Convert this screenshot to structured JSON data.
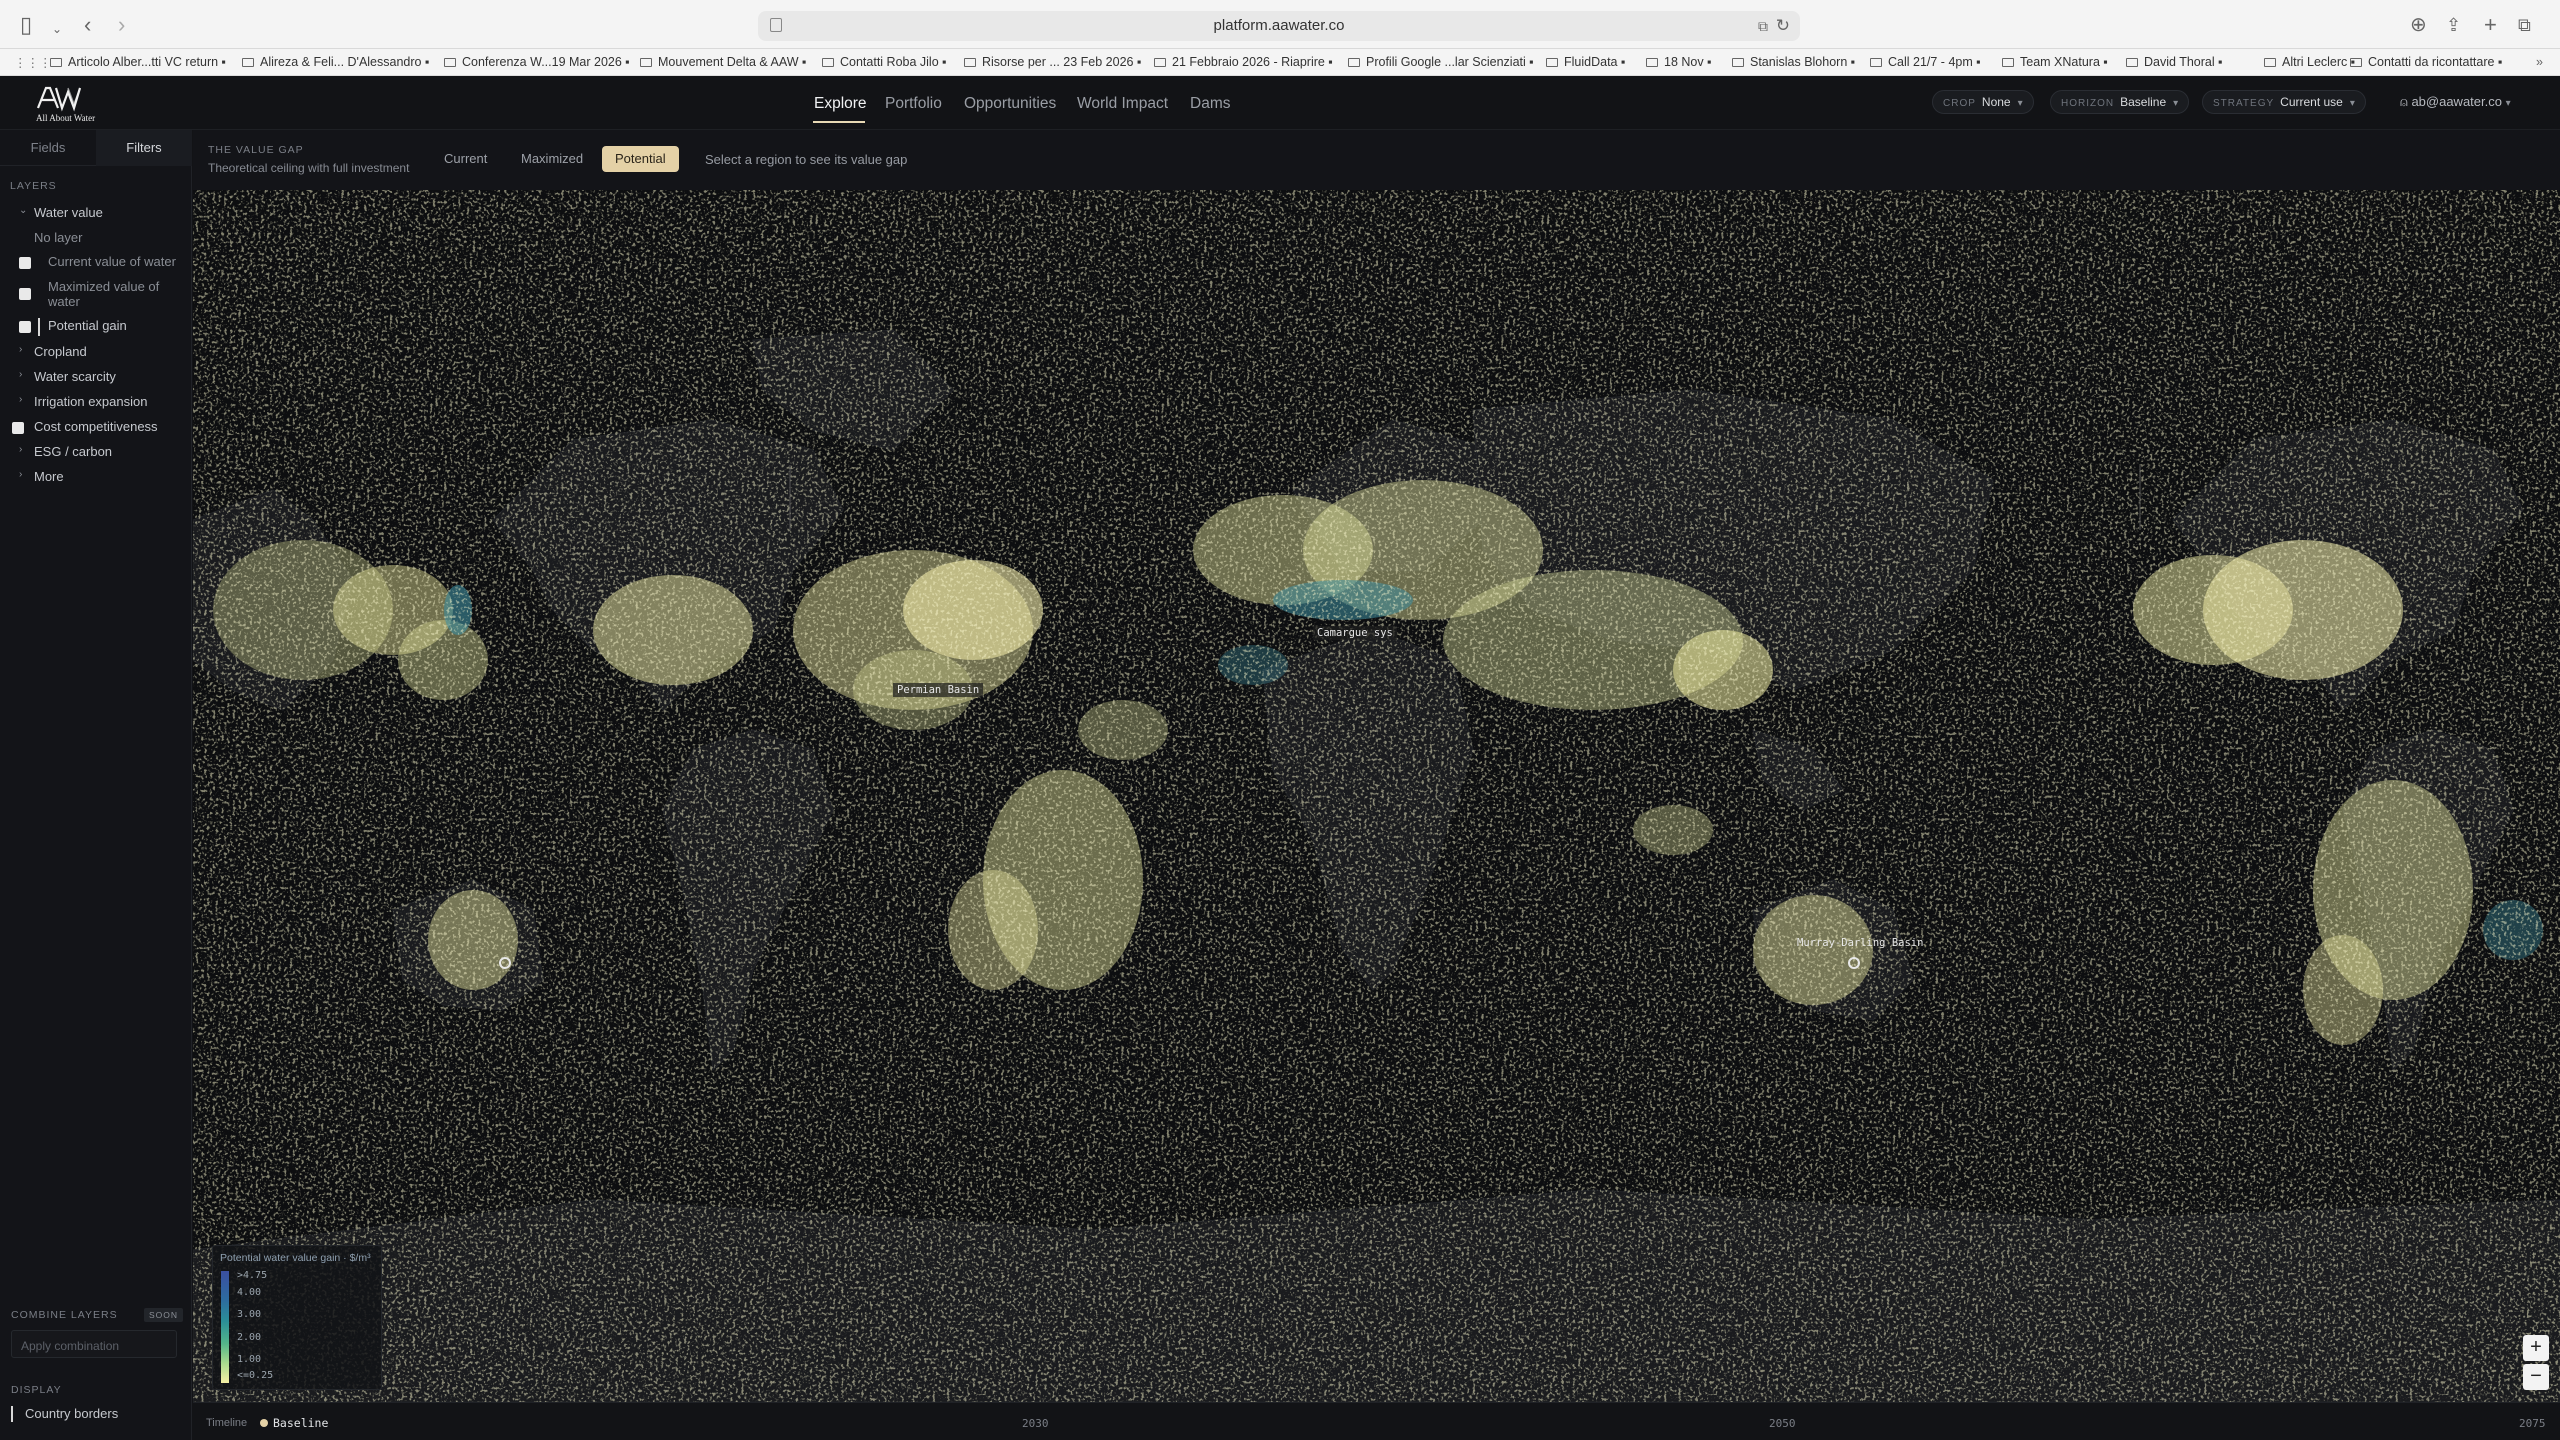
{
  "browser": {
    "url": "platform.aawater.co",
    "bookmarks": [
      "Articolo Alber...tti VC return",
      "Alireza & Feli... D'Alessandro",
      "Conferenza W...19 Mar 2026",
      "Mouvement Delta & AAW",
      "Contatti Roba Jilo",
      "Risorse per ... 23 Feb 2026",
      "21 Febbraio 2026 - Riaprire",
      "Profili Google ...lar Scienziati",
      "FluidData",
      "18 Nov",
      "Stanislas Blohorn",
      "Call 21/7 - 4pm",
      "Team XNatura",
      "David Thoral",
      "Altri Leclerc",
      "Contatti da ricontattare"
    ]
  },
  "app": {
    "logo_text": "All About Water",
    "nav": [
      "Explore",
      "Portfolio",
      "Opportunities",
      "World Impact",
      "Dams"
    ],
    "filters": [
      {
        "key": "CROP",
        "value": "None"
      },
      {
        "key": "HORIZON",
        "value": "Baseline"
      },
      {
        "key": "STRATEGY",
        "value": "Current use"
      }
    ],
    "user": "ab@aawater.co"
  },
  "sidebar": {
    "tabs": [
      "Fields",
      "Filters"
    ],
    "layers_label": "LAYERS",
    "water_value": {
      "label": "Water value",
      "no_layer": "No layer",
      "items": [
        "Current value of water",
        "Maximized value of water",
        "Potential gain"
      ]
    },
    "groups": [
      "Cropland",
      "Water scarcity",
      "Irrigation expansion",
      "Cost competitiveness",
      "ESG / carbon",
      "More"
    ],
    "combine_label": "COMBINE LAYERS",
    "combine_badge": "SOON",
    "combine_placeholder": "Apply combination",
    "display_label": "DISPLAY",
    "display_item": "Country borders"
  },
  "value_gap": {
    "title": "THE VALUE GAP",
    "subtitle": "Theoretical ceiling with full investment",
    "modes": [
      "Current",
      "Maximized",
      "Potential"
    ],
    "active_mode": "Potential",
    "hint": "Select a region to see its value gap"
  },
  "map": {
    "labels": [
      "Camargue sys",
      "Permian Basin",
      "Murray-Darling Basin"
    ]
  },
  "legend": {
    "title": "Potential water value gain · $/m³",
    "ticks": [
      ">4.75",
      "4.00",
      "3.00",
      "2.00",
      "1.00",
      "<=0.25"
    ]
  },
  "timeline": {
    "label": "Timeline",
    "current": "Baseline",
    "years": [
      "2030",
      "2050",
      "2075"
    ]
  },
  "colors": {
    "accent": "#e4d1a6",
    "land": "#1a1b1e",
    "gain_low": "#f5f0a5",
    "gain_high": "#3b4fa0"
  }
}
